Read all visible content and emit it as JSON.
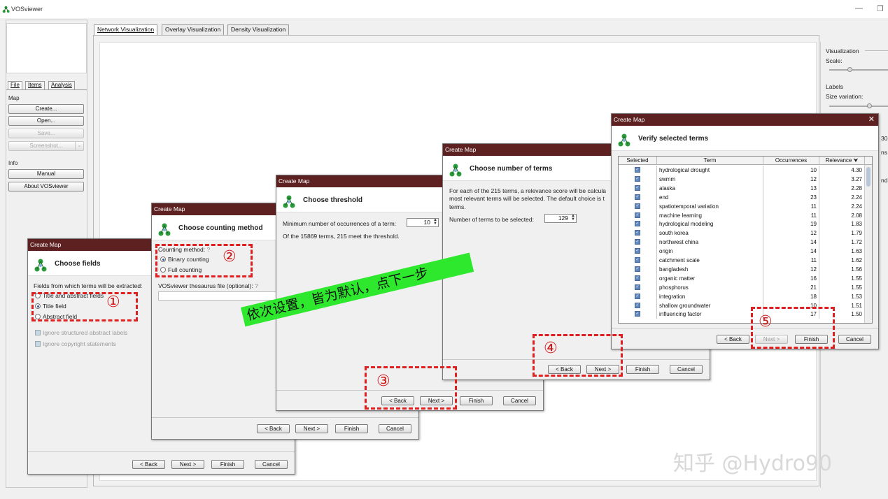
{
  "app": {
    "title": "VOSviewer"
  },
  "left_panel": {
    "tabs": [
      "File",
      "Items",
      "Analysis"
    ],
    "map_section": "Map",
    "buttons": {
      "create": "Create...",
      "open": "Open...",
      "save": "Save...",
      "screenshot": "Screenshot..."
    },
    "info_section": "Info",
    "info_buttons": {
      "manual": "Manual",
      "about": "About VOSviewer"
    }
  },
  "main_tabs": [
    "Network Visualization",
    "Overlay Visualization",
    "Density Visualization"
  ],
  "right_panel": {
    "visualization": "Visualization",
    "scale": "Scale:",
    "labels": "Labels",
    "size_variation": "Size variation:",
    "partial": {
      "n30": "30",
      "ns": "ns",
      "nd": "nd"
    }
  },
  "dialog_title": "Create Map",
  "buttons": {
    "back": "< Back",
    "next": "Next >",
    "finish": "Finish",
    "cancel": "Cancel"
  },
  "dlg1": {
    "heading": "Choose fields",
    "prompt": "Fields from which terms will be extracted:",
    "options": [
      "Title and abstract fields",
      "Title field",
      "Abstract field"
    ],
    "selected": "Title field",
    "ignore_structured": "Ignore structured abstract labels",
    "ignore_copyright": "Ignore copyright statements"
  },
  "dlg2": {
    "heading": "Choose counting method",
    "label": "Counting method:",
    "options": [
      "Binary counting",
      "Full counting"
    ],
    "selected": "Binary counting",
    "thesaurus": "VOSviewer thesaurus file (optional):"
  },
  "dlg3": {
    "heading": "Choose threshold",
    "min_label": "Minimum number of occurrences of a term:",
    "min_value": "10",
    "result": "Of the 15869 terms, 215 meet the threshold."
  },
  "dlg4": {
    "heading": "Choose number of terms",
    "desc1": "For each of the 215 terms, a relevance score will be calcula",
    "desc2": "most relevant terms will be selected. The default choice is t",
    "desc3": "terms.",
    "num_label": "Number of terms to be selected:",
    "num_value": "129"
  },
  "dlg5": {
    "heading": "Verify selected terms",
    "columns": [
      "Selected",
      "Term",
      "Occurrences",
      "Relevance"
    ],
    "sort_indicator": "⮟",
    "rows": [
      [
        "hydrological drought",
        "10",
        "4.30"
      ],
      [
        "swmm",
        "12",
        "3.27"
      ],
      [
        "alaska",
        "13",
        "2.28"
      ],
      [
        "end",
        "23",
        "2.24"
      ],
      [
        "spatiotemporal variation",
        "11",
        "2.24"
      ],
      [
        "machine learning",
        "11",
        "2.08"
      ],
      [
        "hydrological modeling",
        "19",
        "1.83"
      ],
      [
        "south korea",
        "12",
        "1.79"
      ],
      [
        "northwest china",
        "14",
        "1.72"
      ],
      [
        "origin",
        "14",
        "1.63"
      ],
      [
        "catchment scale",
        "11",
        "1.62"
      ],
      [
        "bangladesh",
        "12",
        "1.56"
      ],
      [
        "organic matter",
        "16",
        "1.55"
      ],
      [
        "phosphorus",
        "21",
        "1.55"
      ],
      [
        "integration",
        "18",
        "1.53"
      ],
      [
        "shallow groundwater",
        "10",
        "1.51"
      ],
      [
        "influencing factor",
        "17",
        "1.50"
      ]
    ]
  },
  "annotations": {
    "steps": [
      "①",
      "②",
      "③",
      "④",
      "⑤"
    ],
    "banner": "依次设置，皆为默认，点下一步",
    "watermark": "知乎 @Hydro90",
    "arrow_color": "#e01818",
    "highlight_color": "#e02020",
    "banner_color": "#2ee82e"
  }
}
